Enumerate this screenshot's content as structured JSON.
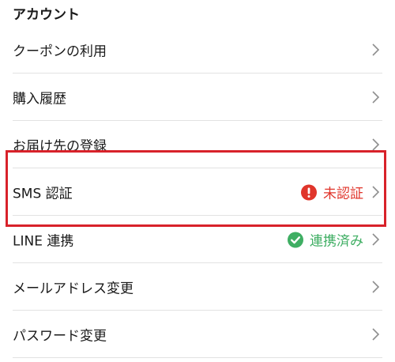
{
  "section": {
    "title": "アカウント"
  },
  "rows": [
    {
      "label": "クーポンの利用"
    },
    {
      "label": "購入履歴"
    },
    {
      "label": "お届け先の登録"
    },
    {
      "label": "SMS 認証",
      "status": "未認証"
    },
    {
      "label": "LINE 連携",
      "status": "連携済み"
    },
    {
      "label": "メールアドレス変更"
    },
    {
      "label": "パスワード変更"
    }
  ],
  "colors": {
    "unverified": "#e0352b",
    "linked": "#3fae63",
    "highlight_border": "#d8222a",
    "divider": "#e2e2e2"
  },
  "icons": {
    "chevron": "chevron-right-icon",
    "unverified": "exclamation-circle-icon",
    "linked": "check-circle-icon"
  }
}
